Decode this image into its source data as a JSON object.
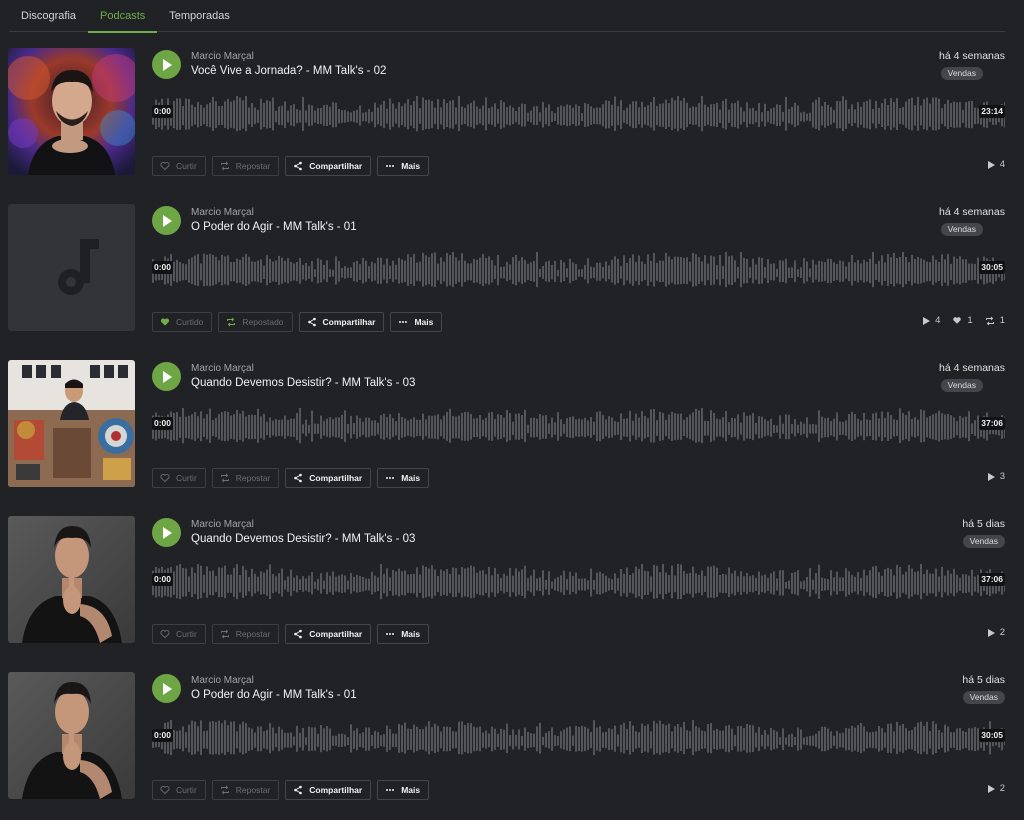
{
  "tabs": [
    {
      "label": "Discografia"
    },
    {
      "label": "Podcasts"
    },
    {
      "label": "Temporadas"
    }
  ],
  "actions": {
    "like": "Curtir",
    "liked": "Curtido",
    "repost": "Repostar",
    "reposted": "Repostado",
    "share": "Compartilhar",
    "more": "Mais"
  },
  "tracks": [
    {
      "artist": "Marcio Marçal",
      "title": "Você Vive a Jornada? - MM Talk's - 02",
      "date": "há 4 semanas",
      "tag": "Vendas",
      "start": "0:00",
      "duration": "23:14",
      "plays": "4",
      "likes": "",
      "reposts": "",
      "liked": false,
      "art": "brain-portrait"
    },
    {
      "artist": "Marcio Marçal",
      "title": "O Poder do Agir - MM Talk's - 01",
      "date": "há 4 semanas",
      "tag": "Vendas",
      "start": "0:00",
      "duration": "30:05",
      "plays": "4",
      "likes": "1",
      "reposts": "1",
      "liked": true,
      "art": "music-note-placeholder"
    },
    {
      "artist": "Marcio Marçal",
      "title": "Quando Devemos Desistir? - MM Talk's - 03",
      "date": "há 4 semanas",
      "tag": "Vendas",
      "start": "0:00",
      "duration": "37:06",
      "plays": "3",
      "likes": "",
      "reposts": "",
      "liked": false,
      "art": "studio-photo"
    },
    {
      "artist": "Marcio Marçal",
      "title": "Quando Devemos Desistir? - MM Talk's - 03",
      "date": "há 5 dias",
      "tag": "Vendas",
      "start": "0:00",
      "duration": "37:06",
      "plays": "2",
      "likes": "",
      "reposts": "",
      "liked": false,
      "art": "silence-portrait"
    },
    {
      "artist": "Marcio Marçal",
      "title": "O Poder do Agir - MM Talk's - 01",
      "date": "há 5 dias",
      "tag": "Vendas",
      "start": "0:00",
      "duration": "30:05",
      "plays": "2",
      "likes": "",
      "reposts": "",
      "liked": false,
      "art": "silence-portrait"
    }
  ],
  "colors": {
    "accent": "#6fae4a",
    "background": "#212226",
    "waveform": "#55565b"
  }
}
